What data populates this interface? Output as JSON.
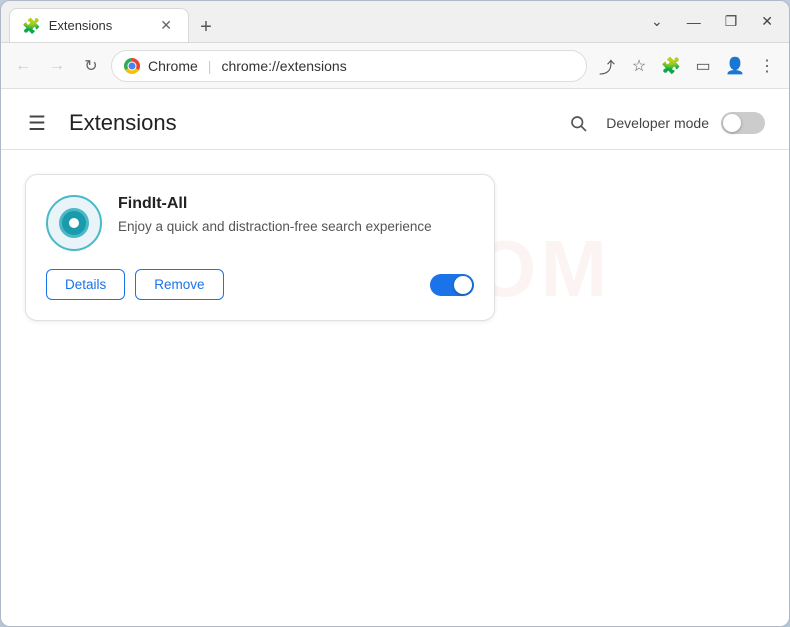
{
  "browser": {
    "tab": {
      "icon": "🧩",
      "title": "Extensions",
      "close": "✕"
    },
    "new_tab_label": "+",
    "window_controls": {
      "minimize": "—",
      "maximize": "❐",
      "close": "✕"
    },
    "nav": {
      "back": "←",
      "forward": "→",
      "refresh": "↻"
    },
    "address": {
      "site_name": "Chrome",
      "url": "chrome://extensions"
    },
    "toolbar_icons": [
      "⤴",
      "☆",
      "🧩",
      "□",
      "👤",
      "⋮"
    ]
  },
  "page": {
    "title": "Extensions",
    "hamburger": "☰",
    "search_label": "🔍",
    "developer_mode_label": "Developer mode",
    "developer_mode_on": false
  },
  "extension": {
    "name": "FindIt-All",
    "description": "Enjoy a quick and distraction-free search experience",
    "details_label": "Details",
    "remove_label": "Remove",
    "enabled": true
  },
  "watermark": {
    "text": "RISK.COM"
  }
}
